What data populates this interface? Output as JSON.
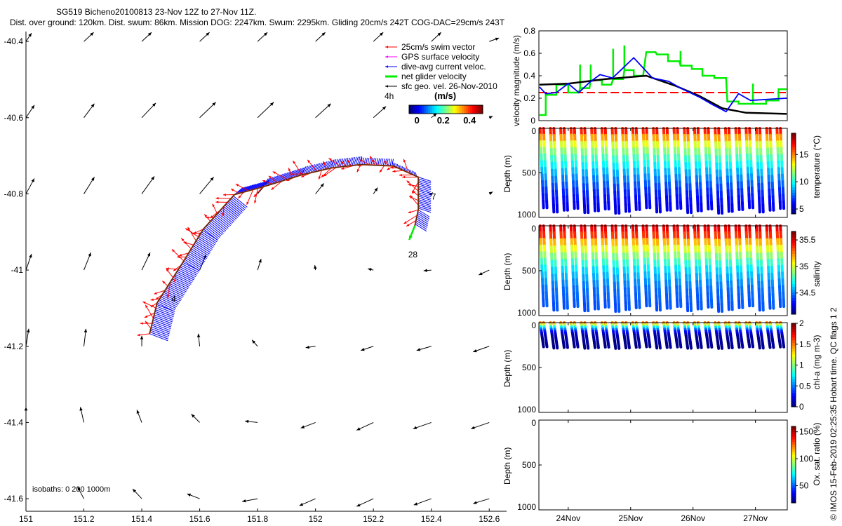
{
  "title": {
    "line1": "SG519 Bicheno20100813 23-Nov 12Z to 27-Nov 11Z.",
    "line2": "Dist. over ground: 120km. Dist. swum: 86km. Mission DOG: 2247km. Swum: 2295km. Gliding 20cm/s 242T COG-DAC=29cm/s 243T"
  },
  "copyright": "© IMOS 15-Feb-2019 02:25:35 Hobart time. QC flags 1  2",
  "colors": {
    "swim": "#ff0000",
    "gps": "#ff00ff",
    "current": "#0000ff",
    "net": "#00ee00",
    "geo": "#000000",
    "ref_line": "#ff0000",
    "glider_speed": "#00ee00",
    "current_speed": "#0000ff",
    "geo_speed": "#000000"
  },
  "chart_data": [
    {
      "type": "vector-map",
      "xlim": [
        151,
        152.66
      ],
      "ylim": [
        -41.633,
        -40.374
      ],
      "xticks": [
        "151",
        "151.2",
        "151.4",
        "151.6",
        "151.8",
        "152",
        "152.2",
        "152.4",
        "152.6"
      ],
      "xtick_values": [
        151,
        151.2,
        151.4,
        151.6,
        151.8,
        152,
        152.2,
        152.4,
        152.6
      ],
      "yticks": [
        "-40.4",
        "-40.6",
        "-40.8",
        "-41",
        "-41.2",
        "-41.4",
        "-41.6"
      ],
      "ytick_values": [
        -40.4,
        -40.6,
        -40.8,
        -41,
        -41.2,
        -41.4,
        -41.6
      ],
      "legend": [
        {
          "label": "25cm/s swim vector",
          "color": "#ff0000"
        },
        {
          "label": "GPS surface velocity",
          "color": "#ff00ff"
        },
        {
          "label": "dive-avg current veloc.",
          "color": "#0000ff"
        },
        {
          "label": "net glider velocity",
          "color": "#00ee00"
        },
        {
          "label": "sfc geo. vel. 26-Nov-2010",
          "color": "#000000"
        }
      ],
      "legend_interval": "4h",
      "colorbar": {
        "label": "(m/s)",
        "ticks": [
          "0",
          "0.2",
          "0.4"
        ],
        "tick_values": [
          0,
          0.2,
          0.4
        ],
        "range": [
          -0.06,
          0.5
        ]
      },
      "isobaths_label": "isobaths: 0   200   1000m",
      "track": [
        [
          151.427,
          -41.167
        ],
        [
          151.453,
          -41.086
        ],
        [
          151.545,
          -40.976
        ],
        [
          151.613,
          -40.892
        ],
        [
          151.72,
          -40.802
        ],
        [
          151.817,
          -40.782
        ],
        [
          151.953,
          -40.75
        ],
        [
          152.055,
          -40.732
        ],
        [
          152.156,
          -40.723
        ],
        [
          152.27,
          -40.727
        ],
        [
          152.355,
          -40.756
        ],
        [
          152.355,
          -40.842
        ],
        [
          152.343,
          -40.884
        ]
      ],
      "current_uv_by_leg": [
        [
          0.26,
          -0.1
        ],
        [
          0.24,
          -0.12
        ],
        [
          0.22,
          -0.14
        ],
        [
          0.2,
          -0.16
        ],
        [
          0.12,
          0.1
        ],
        [
          0.08,
          0.12
        ],
        [
          0.06,
          0.12
        ],
        [
          0.04,
          0.12
        ],
        [
          0.02,
          0.1
        ],
        [
          -0.02,
          0.06
        ],
        [
          0.18,
          -0.06
        ],
        [
          0.16,
          -0.1
        ]
      ],
      "net_glider_velocity": [
        -0.08,
        -0.2
      ],
      "track_labels": [
        {
          "text": "4",
          "lon": 151.502,
          "lat": -41.084
        },
        {
          "text": "7",
          "lon": 152.4,
          "lat": -40.815
        },
        {
          "text": "28",
          "lon": 152.32,
          "lat": -40.967
        }
      ],
      "geo_vectors": {
        "lons": [
          151,
          151.2,
          151.4,
          151.6,
          151.8,
          152,
          152.2,
          152.4,
          152.6
        ],
        "lats": [
          -40.4,
          -40.6,
          -40.8,
          -41,
          -41.2,
          -41.4,
          -41.6
        ],
        "uv": [
          [
            [
              0.08,
              0.12
            ],
            [
              0.14,
              0.13
            ],
            [
              0.14,
              0.13
            ],
            [
              0.14,
              0.13
            ],
            [
              0.14,
              0.13
            ],
            [
              0.14,
              0.13
            ],
            [
              0.14,
              0.13
            ],
            [
              0.14,
              0.13
            ],
            [
              0.14,
              0.05
            ]
          ],
          [
            [
              0.12,
              0.18
            ],
            [
              0.15,
              0.2
            ],
            [
              0.2,
              0.21
            ],
            [
              0.23,
              0.22
            ],
            [
              0.23,
              0.22
            ],
            [
              0.22,
              0.2
            ],
            [
              0.18,
              0.16
            ],
            [
              0.08,
              0.06
            ],
            [
              0.05,
              0.02
            ]
          ],
          [
            [
              0.12,
              0.22
            ],
            [
              0.15,
              0.24
            ],
            [
              0.18,
              0.25
            ],
            [
              0.2,
              0.24
            ],
            [
              0.17,
              0.2
            ],
            [
              0.12,
              0.15
            ],
            [
              0.06,
              0.09
            ],
            [
              0.02,
              0.02
            ],
            [
              0.05,
              0.03
            ]
          ],
          [
            [
              0.08,
              0.23
            ],
            [
              0.1,
              0.25
            ],
            [
              0.12,
              0.25
            ],
            [
              0.09,
              0.22
            ],
            [
              0.05,
              0.16
            ],
            [
              -0.01,
              0.07
            ],
            [
              -0.08,
              0.02
            ],
            [
              -0.11,
              -0.01
            ],
            [
              -0.15,
              -0.07
            ]
          ],
          [
            [
              0.04,
              0.25
            ],
            [
              0.03,
              0.25
            ],
            [
              0.0,
              0.15
            ],
            [
              -0.02,
              0.18
            ],
            [
              -0.08,
              0.09
            ],
            [
              -0.14,
              -0.02
            ],
            [
              -0.18,
              -0.06
            ],
            [
              -0.21,
              -0.06
            ],
            [
              -0.23,
              -0.08
            ]
          ],
          [
            [
              0.0,
              0.22
            ],
            [
              -0.05,
              0.22
            ],
            [
              -0.07,
              0.18
            ],
            [
              -0.12,
              0.12
            ],
            [
              -0.18,
              0.02
            ],
            [
              -0.21,
              -0.08
            ],
            [
              -0.24,
              -0.11
            ],
            [
              -0.26,
              -0.09
            ],
            [
              -0.26,
              -0.09
            ]
          ],
          [
            null,
            [
              -0.09,
              0.17
            ],
            [
              -0.13,
              0.14
            ],
            [
              -0.18,
              0.07
            ],
            [
              -0.22,
              -0.04
            ],
            [
              -0.23,
              -0.1
            ],
            [
              -0.24,
              -0.11
            ],
            [
              -0.25,
              -0.09
            ],
            [
              -0.23,
              -0.07
            ]
          ]
        ]
      }
    },
    {
      "type": "line",
      "ylabel": "velocity magnitude (m/s)",
      "xlim": [
        23.53,
        27.51
      ],
      "ylim": [
        0,
        0.8
      ],
      "yticks": [
        "0",
        "0.2",
        "0.4",
        "0.6",
        "0.8"
      ],
      "ytick_values": [
        0,
        0.2,
        0.4,
        0.6,
        0.8
      ],
      "reference_line": 0.25,
      "current_speed": [
        [
          23.54,
          0.3
        ],
        [
          23.64,
          0.24
        ],
        [
          23.81,
          0.25
        ],
        [
          24.0,
          0.33
        ],
        [
          24.17,
          0.25
        ],
        [
          24.34,
          0.34
        ],
        [
          24.51,
          0.41
        ],
        [
          24.71,
          0.38
        ],
        [
          25.05,
          0.56
        ],
        [
          25.35,
          0.38
        ],
        [
          25.61,
          0.35
        ],
        [
          25.8,
          0.29
        ],
        [
          26.1,
          0.21
        ],
        [
          26.32,
          0.14
        ],
        [
          26.53,
          0.08
        ],
        [
          26.73,
          0.24
        ],
        [
          26.92,
          0.18
        ],
        [
          27.5,
          0.2
        ]
      ],
      "geo_speed": [
        [
          23.54,
          0.32
        ],
        [
          24.0,
          0.33
        ],
        [
          24.6,
          0.37
        ],
        [
          25.25,
          0.4
        ],
        [
          25.72,
          0.31
        ],
        [
          26.1,
          0.22
        ],
        [
          26.47,
          0.11
        ],
        [
          26.85,
          0.07
        ],
        [
          27.5,
          0.06
        ]
      ],
      "glider_speed_steps": [
        [
          23.54,
          23.64,
          0.05
        ],
        [
          23.64,
          23.81,
          0.23
        ],
        [
          23.81,
          24.0,
          0.32
        ],
        [
          24.0,
          24.17,
          0.25
        ],
        [
          24.19,
          24.34,
          0.29
        ],
        [
          24.36,
          24.54,
          0.36
        ],
        [
          24.54,
          24.69,
          0.32
        ],
        [
          24.72,
          24.88,
          0.37
        ],
        [
          24.9,
          25.05,
          0.45
        ],
        [
          25.05,
          25.2,
          0.4
        ],
        [
          25.25,
          25.4,
          0.61
        ],
        [
          25.42,
          25.6,
          0.59
        ],
        [
          25.6,
          25.78,
          0.53
        ],
        [
          25.8,
          25.98,
          0.49
        ],
        [
          25.98,
          26.15,
          0.46
        ],
        [
          26.15,
          26.34,
          0.4
        ],
        [
          26.34,
          26.53,
          0.38
        ],
        [
          26.55,
          26.73,
          0.17
        ],
        [
          26.73,
          26.94,
          0.15
        ],
        [
          26.96,
          27.17,
          0.15
        ],
        [
          27.17,
          27.37,
          0.18
        ],
        [
          27.37,
          27.5,
          0.28
        ]
      ],
      "glider_speed_spikes": [
        [
          24.19,
          0.5
        ],
        [
          24.36,
          0.5
        ],
        [
          24.72,
          0.64
        ],
        [
          24.9,
          0.67
        ],
        [
          25.8,
          0.62
        ],
        [
          26.96,
          0.33
        ]
      ]
    },
    {
      "type": "section",
      "xlim": [
        23.53,
        27.51
      ],
      "xticks": [
        "24Nov",
        "25Nov",
        "26Nov",
        "27Nov"
      ],
      "xtick_values": [
        24,
        25,
        26,
        27
      ],
      "ylabel": "Depth (m)",
      "ylim": [
        0,
        1000
      ],
      "yticks": [
        "0",
        "500",
        "1000"
      ],
      "ytick_values": [
        0,
        500,
        1000
      ],
      "dive_times": [
        23.55,
        23.715,
        23.88,
        24.045,
        24.21,
        24.375,
        24.54,
        24.705,
        24.87,
        25.035,
        25.2,
        25.365,
        25.53,
        25.695,
        25.86,
        26.025,
        26.19,
        26.355,
        26.52,
        26.685,
        26.85,
        27.015,
        27.18,
        27.345
      ],
      "panels": [
        {
          "variable": "temperature",
          "cbar_label": "temperature (°C)",
          "clim": [
            4.1,
            18.9
          ],
          "cbar_ticks": [
            "5",
            "10",
            "15"
          ],
          "cbar_tick_values": [
            5,
            10,
            15
          ],
          "max_depth": 960,
          "profile_depth": [
            0,
            100,
            200,
            300,
            500,
            700,
            1000
          ],
          "profile_value": [
            17.5,
            15,
            12.5,
            11,
            8.5,
            6.5,
            5
          ]
        },
        {
          "variable": "salinity",
          "cbar_label": "salinity",
          "clim": [
            34.1,
            35.66
          ],
          "cbar_ticks": [
            "34.5",
            "35",
            "35.5"
          ],
          "cbar_tick_values": [
            34.5,
            35,
            35.5
          ],
          "max_depth": 960,
          "profile_depth": [
            0,
            100,
            200,
            300,
            500,
            700,
            1000
          ],
          "profile_value": [
            35.5,
            35.42,
            35.15,
            34.95,
            34.62,
            34.45,
            34.38
          ]
        },
        {
          "variable": "chl-a",
          "cbar_label": "chl-a (mg m-3)",
          "clim": [
            0,
            2
          ],
          "cbar_ticks": [
            "0",
            "0.5",
            "1",
            "1.5",
            "2"
          ],
          "cbar_tick_values": [
            0,
            0.5,
            1,
            1.5,
            2
          ],
          "max_depth": 290,
          "profile_depth": [
            0,
            30,
            60,
            100,
            150,
            300
          ],
          "profile_value": [
            1.7,
            1.2,
            0.7,
            0.3,
            0.05,
            0
          ]
        },
        {
          "variable": "oxygen",
          "cbar_label": "Ox. sat. ratio (%)",
          "clim": [
            18,
            160
          ],
          "cbar_ticks": [
            "50",
            "100",
            "150"
          ],
          "cbar_tick_values": [
            50,
            100,
            150
          ],
          "max_depth": 0,
          "profile_depth": [],
          "profile_value": []
        }
      ]
    }
  ]
}
